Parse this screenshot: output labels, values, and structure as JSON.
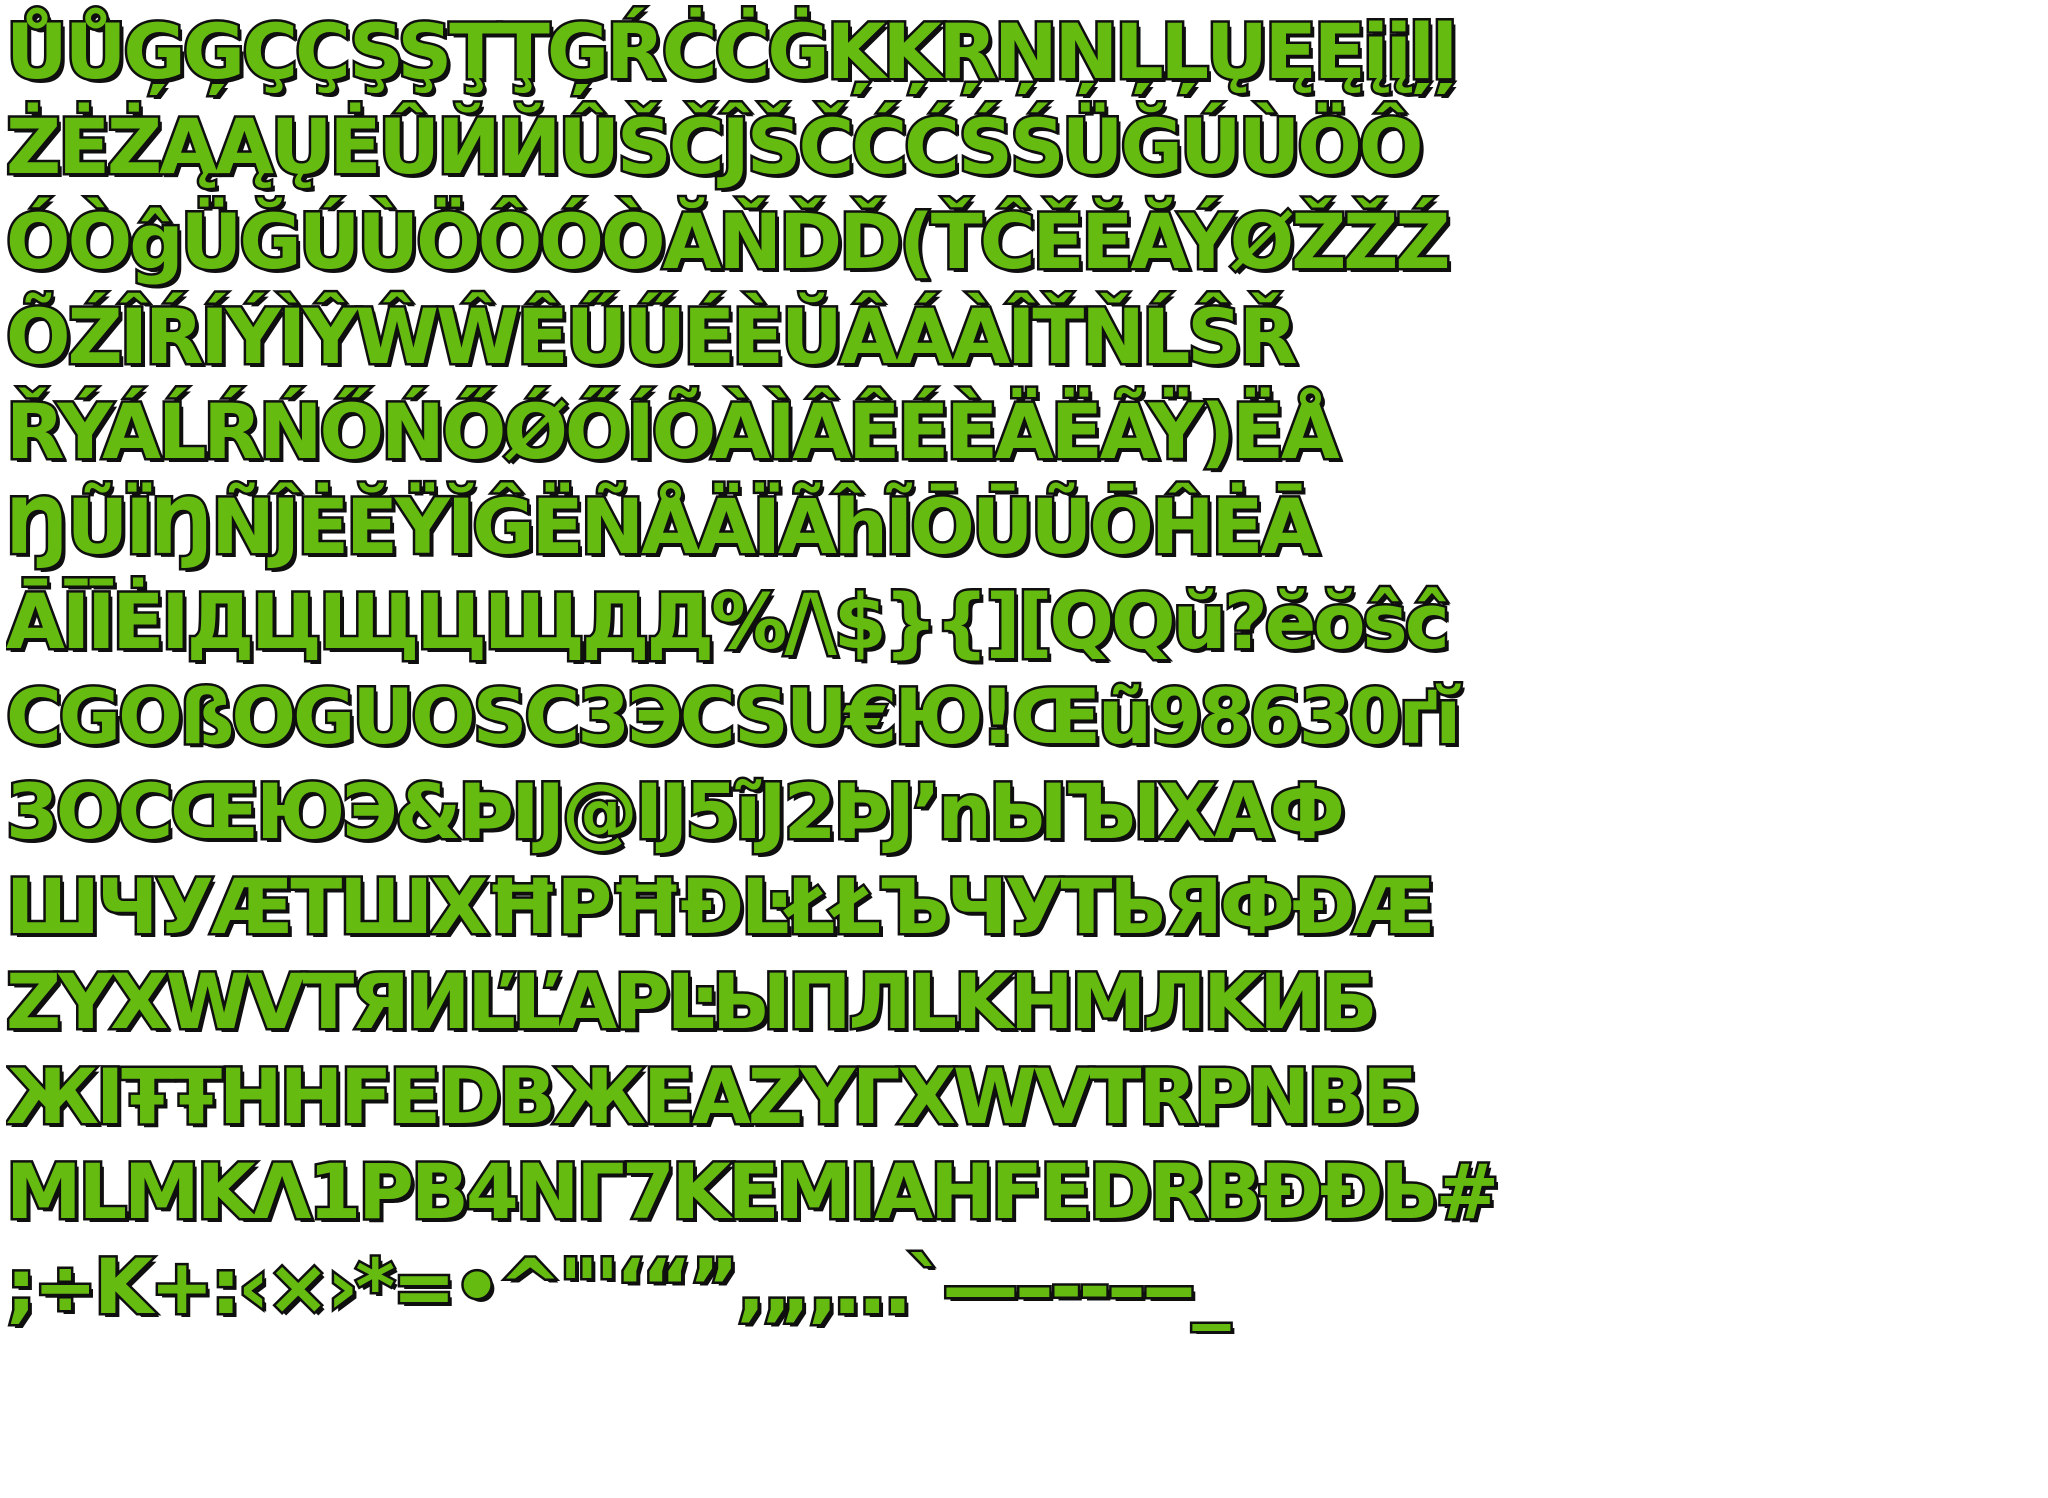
{
  "atlas": {
    "fill_color": "#66bb11",
    "outline_color": "#0f0f0f",
    "background_color": "#ffffff",
    "rows": [
      "ŮŮĢĢÇÇŞŞŢŢĢŔĊĊĠĶĶŖŅŅĻĻŲĘĘįįļļ",
      "ŻĖŻĄĄŲĖÛЙЙÛŠČĴŠČĆĆŚŚÜĞÚÙÖÔ",
      "ÓÒĝÜĞÚÙÖÔÓÒĂŇĎĎ(ŤĈĚĔĂÝØŽŽŹ",
      "ÕŹÎŔÍÝÌŶŴŴÊŰŰÉÈŬÂÁÀÎŤŇĹŜŘ",
      "ŘÝÁĹŔŃŐŃŐǾŐÍÕÀÌÂÊÉÈÄËÃŸ)ËÅ",
      "ŊŨÏŊÑĴĖĔŸĬĜËÑÅÄÏÃĥĨŌŪŨŌĤĖĀ",
      "ĀĪĪĖІДЦЩЦЩДД%/\\$}{][QQŭ?ĕŏŝĉ",
      "CGOßOGUOSC3ЭCSU€Ю!Œũ98630ґĭ",
      "3OCŒЮЭ&ÞIJ@IJ5ĩJ2ÞJʼnЫЪIXAФ",
      "ШЧУÆTШXĦPĦĐĿŁŁЪЧУТЬЯФĐÆ",
      "ZYXWVTЯИĽĽAPĿЫПЛLKHMЛKИБ",
      "ЖIŦŦHHFEDBЖEAZYГXWVTRPNBБ",
      "MLMKΛ1PB4NГ7KEMIAHFEDRBĐĐЬ#",
      ";÷K+:‹×›*=•^\"'‘“”‚„,…`—–-‑–‒_"
    ]
  }
}
